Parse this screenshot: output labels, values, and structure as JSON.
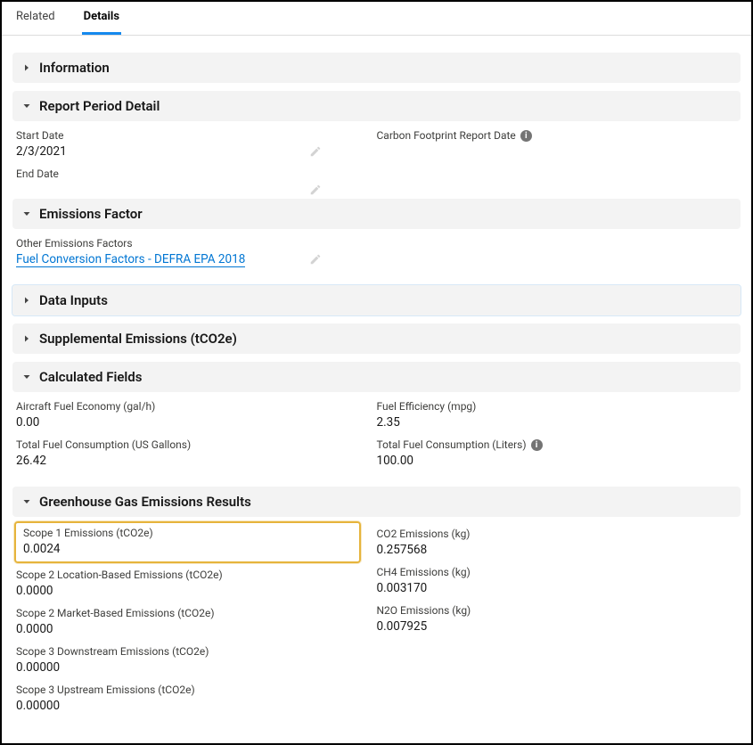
{
  "tabs": {
    "related": "Related",
    "details": "Details"
  },
  "sections": {
    "information": {
      "title": "Information"
    },
    "reportPeriod": {
      "title": "Report Period Detail",
      "startDate": {
        "label": "Start Date",
        "value": "2/3/2021"
      },
      "endDate": {
        "label": "End Date",
        "value": ""
      },
      "carbonFootprintReportDate": {
        "label": "Carbon Footprint Report Date",
        "value": ""
      }
    },
    "emissionsFactor": {
      "title": "Emissions Factor",
      "otherFactors": {
        "label": "Other Emissions Factors",
        "link": "Fuel Conversion Factors - DEFRA EPA 2018"
      }
    },
    "dataInputs": {
      "title": "Data Inputs"
    },
    "supplemental": {
      "title": "Supplemental Emissions (tCO2e)"
    },
    "calculated": {
      "title": "Calculated Fields",
      "aircraftFuelEconomy": {
        "label": "Aircraft Fuel Economy (gal/h)",
        "value": "0.00"
      },
      "totalFuelUS": {
        "label": "Total Fuel Consumption (US Gallons)",
        "value": "26.42"
      },
      "fuelEfficiency": {
        "label": "Fuel Efficiency (mpg)",
        "value": "2.35"
      },
      "totalFuelLiters": {
        "label": "Total Fuel Consumption (Liters)",
        "value": "100.00"
      }
    },
    "ghg": {
      "title": "Greenhouse Gas Emissions Results",
      "scope1": {
        "label": "Scope 1 Emissions (tCO2e)",
        "value": "0.0024"
      },
      "scope2loc": {
        "label": "Scope 2 Location-Based Emissions (tCO2e)",
        "value": "0.0000"
      },
      "scope2mkt": {
        "label": "Scope 2 Market-Based Emissions (tCO2e)",
        "value": "0.0000"
      },
      "scope3down": {
        "label": "Scope 3 Downstream Emissions (tCO2e)",
        "value": "0.00000"
      },
      "scope3up": {
        "label": "Scope 3 Upstream Emissions (tCO2e)",
        "value": "0.00000"
      },
      "co2": {
        "label": "CO2 Emissions (kg)",
        "value": "0.257568"
      },
      "ch4": {
        "label": "CH4 Emissions (kg)",
        "value": "0.003170"
      },
      "n2o": {
        "label": "N2O Emissions (kg)",
        "value": "0.007925"
      }
    }
  }
}
